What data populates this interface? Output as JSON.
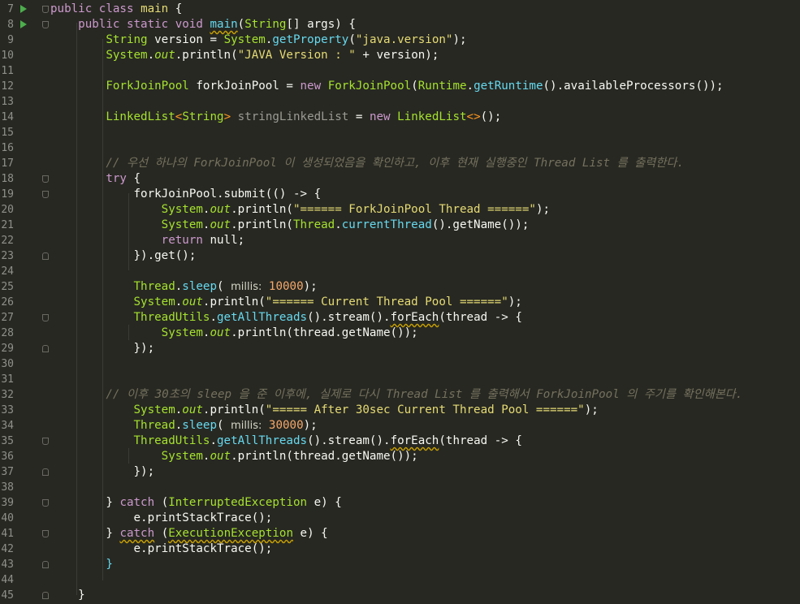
{
  "editor": {
    "lines": [
      {
        "no": "7",
        "run": true,
        "fold": "down"
      },
      {
        "no": "8",
        "run": true,
        "fold": "down"
      },
      {
        "no": "9"
      },
      {
        "no": "10"
      },
      {
        "no": "11"
      },
      {
        "no": "12"
      },
      {
        "no": "13"
      },
      {
        "no": "14"
      },
      {
        "no": "15"
      },
      {
        "no": "16"
      },
      {
        "no": "17"
      },
      {
        "no": "18",
        "fold": "down"
      },
      {
        "no": "19",
        "fold": "down"
      },
      {
        "no": "20"
      },
      {
        "no": "21"
      },
      {
        "no": "22"
      },
      {
        "no": "23",
        "fold": "up"
      },
      {
        "no": "24"
      },
      {
        "no": "25"
      },
      {
        "no": "26"
      },
      {
        "no": "27",
        "fold": "down"
      },
      {
        "no": "28"
      },
      {
        "no": "29",
        "fold": "up"
      },
      {
        "no": "30"
      },
      {
        "no": "31"
      },
      {
        "no": "32"
      },
      {
        "no": "33"
      },
      {
        "no": "34"
      },
      {
        "no": "35",
        "fold": "down"
      },
      {
        "no": "36"
      },
      {
        "no": "37",
        "fold": "up"
      },
      {
        "no": "38"
      },
      {
        "no": "39",
        "fold": "down"
      },
      {
        "no": "40"
      },
      {
        "no": "41",
        "fold": "down"
      },
      {
        "no": "42"
      },
      {
        "no": "43",
        "fold": "up"
      },
      {
        "no": "44"
      },
      {
        "no": "45",
        "fold": "up"
      }
    ],
    "tokens": {
      "l7_public": "public",
      "l7_class": "class",
      "l7_name": "main",
      "l7_brace": " {",
      "l8_public": "public",
      "l8_static": "static",
      "l8_void": "void",
      "l8_main": "main",
      "l8_open": "(",
      "l8_String": "String",
      "l8_args": "[] args) {",
      "l9_String": "String",
      "l9_version": " version = ",
      "l9_System": "System",
      "l9_dot": ".",
      "l9_getProperty": "getProperty",
      "l9_open": "(",
      "l9_str": "\"java.version\"",
      "l9_end": ");",
      "l10_System": "System",
      "l10_dot": ".",
      "l10_out": "out",
      "l10_println": ".println(",
      "l10_str": "\"JAVA Version : \"",
      "l10_rest": " + version);",
      "l12_Type": "ForkJoinPool",
      "l12_var": " forkJoinPool = ",
      "l12_new": "new",
      "l12_sp": " ",
      "l12_Type2": "ForkJoinPool",
      "l12_open": "(",
      "l12_Runtime": "Runtime",
      "l12_dot": ".",
      "l12_getRuntime": "getRuntime",
      "l12_paren": "()",
      "l12_avail": ".availableProcessors",
      "l12_end": "());",
      "l14_LinkedList": "LinkedList",
      "l14_lt": "<",
      "l14_String": "String",
      "l14_gt": ">",
      "l14_var": " stringLinkedList",
      "l14_eq": " = ",
      "l14_new": "new",
      "l14_sp": " ",
      "l14_LinkedList2": "LinkedList",
      "l14_diamond": "<>",
      "l14_end": "();",
      "l17_comment": "// 우선 하나의 ForkJoinPool 이 생성되었음을 확인하고, 이후 현재 실행중인 Thread List 를 출력한다.",
      "l18_try": "try",
      "l18_brace": " {",
      "l19_a": "forkJoinPool.submit",
      "l19_b": "(() -> {",
      "l20_System": "System",
      "l20_dot": ".",
      "l20_out": "out",
      "l20_println": ".println(",
      "l20_str": "\"====== ForkJoinPool Thread ======\"",
      "l20_end": ");",
      "l21_System": "System",
      "l21_dot": ".",
      "l21_out": "out",
      "l21_println": ".println(",
      "l21_Thread": "Thread",
      "l21_dot2": ".",
      "l21_cur": "currentThread",
      "l21_rest": "().getName());",
      "l22_return": "return",
      "l22_null": " null;",
      "l23_a": "}).get();",
      "l25_Thread": "Thread",
      "l25_dot": ".",
      "l25_sleep": "sleep",
      "l25_open": "( ",
      "l25_hint": "millis:",
      "l25_num": " 10000",
      "l25_end": ");",
      "l26_System": "System",
      "l26_dot": ".",
      "l26_out": "out",
      "l26_println": ".println(",
      "l26_str": "\"====== Current Thread Pool ======\"",
      "l26_end": ");",
      "l27_TU": "ThreadUtils",
      "l27_dot": ".",
      "l27_get": "getAllThreads",
      "l27_stream": "().stream().",
      "l27_forEach": "forEach",
      "l27_rest": "(thread -> {",
      "l28_System": "System",
      "l28_dot": ".",
      "l28_out": "out",
      "l28_println": ".println(",
      "l28_rest": "thread.getName());",
      "l29_a": "});",
      "l32_comment": "// 이후 30초의 sleep 을 준 이후에, 실제로 다시 Thread List 를 출력해서 ForkJoinPool 의 주기를 확인해본다.",
      "l33_System": "System",
      "l33_dot": ".",
      "l33_out": "out",
      "l33_println": ".println(",
      "l33_str": "\"===== After 30sec Current Thread Pool ======\"",
      "l33_end": ");",
      "l34_Thread": "Thread",
      "l34_dot": ".",
      "l34_sleep": "sleep",
      "l34_open": "( ",
      "l34_hint": "millis:",
      "l34_num": " 30000",
      "l34_end": ");",
      "l35_TU": "ThreadUtils",
      "l35_dot": ".",
      "l35_get": "getAllThreads",
      "l35_stream": "().stream().",
      "l35_forEach": "forEach",
      "l35_rest": "(thread -> {",
      "l36_System": "System",
      "l36_dot": ".",
      "l36_out": "out",
      "l36_println": ".println(",
      "l36_rest": "thread.getName());",
      "l37_a": "});",
      "l39_brace": "} ",
      "l39_catch": "catch",
      "l39_open": " (",
      "l39_Type": "InterruptedException",
      "l39_rest": " e) {",
      "l40_a": "e.printStackTrace();",
      "l41_brace": "} ",
      "l41_catch": "catch",
      "l41_open": " (",
      "l41_Type": "ExecutionException",
      "l41_rest": " e) {",
      "l42_a": "e.printStackTrace();",
      "l43_a": "}",
      "l45_a": "}"
    }
  },
  "colors": {
    "background": "#272822",
    "keyword": "#cc99cd",
    "type": "#a6e22e",
    "method": "#66d9ef",
    "string": "#e6db74",
    "number": "#f4a86b",
    "comment": "#75715e",
    "run_icon": "#4cae4c"
  }
}
